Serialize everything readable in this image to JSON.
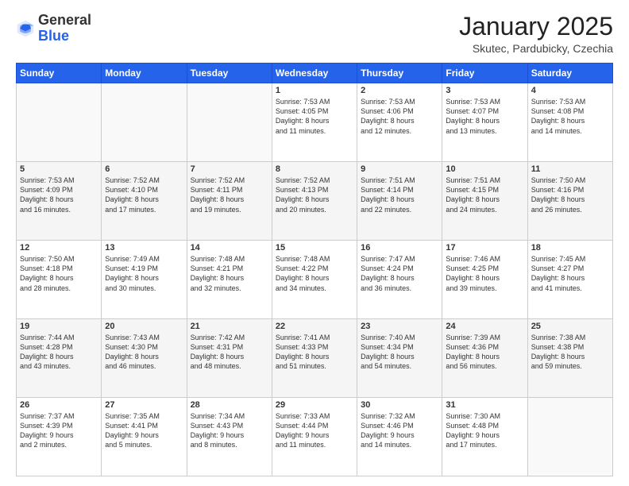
{
  "logo": {
    "general": "General",
    "blue": "Blue"
  },
  "header": {
    "month": "January 2025",
    "location": "Skutec, Pardubicky, Czechia"
  },
  "days_of_week": [
    "Sunday",
    "Monday",
    "Tuesday",
    "Wednesday",
    "Thursday",
    "Friday",
    "Saturday"
  ],
  "weeks": [
    [
      {
        "day": "",
        "info": ""
      },
      {
        "day": "",
        "info": ""
      },
      {
        "day": "",
        "info": ""
      },
      {
        "day": "1",
        "info": "Sunrise: 7:53 AM\nSunset: 4:05 PM\nDaylight: 8 hours\nand 11 minutes."
      },
      {
        "day": "2",
        "info": "Sunrise: 7:53 AM\nSunset: 4:06 PM\nDaylight: 8 hours\nand 12 minutes."
      },
      {
        "day": "3",
        "info": "Sunrise: 7:53 AM\nSunset: 4:07 PM\nDaylight: 8 hours\nand 13 minutes."
      },
      {
        "day": "4",
        "info": "Sunrise: 7:53 AM\nSunset: 4:08 PM\nDaylight: 8 hours\nand 14 minutes."
      }
    ],
    [
      {
        "day": "5",
        "info": "Sunrise: 7:53 AM\nSunset: 4:09 PM\nDaylight: 8 hours\nand 16 minutes."
      },
      {
        "day": "6",
        "info": "Sunrise: 7:52 AM\nSunset: 4:10 PM\nDaylight: 8 hours\nand 17 minutes."
      },
      {
        "day": "7",
        "info": "Sunrise: 7:52 AM\nSunset: 4:11 PM\nDaylight: 8 hours\nand 19 minutes."
      },
      {
        "day": "8",
        "info": "Sunrise: 7:52 AM\nSunset: 4:13 PM\nDaylight: 8 hours\nand 20 minutes."
      },
      {
        "day": "9",
        "info": "Sunrise: 7:51 AM\nSunset: 4:14 PM\nDaylight: 8 hours\nand 22 minutes."
      },
      {
        "day": "10",
        "info": "Sunrise: 7:51 AM\nSunset: 4:15 PM\nDaylight: 8 hours\nand 24 minutes."
      },
      {
        "day": "11",
        "info": "Sunrise: 7:50 AM\nSunset: 4:16 PM\nDaylight: 8 hours\nand 26 minutes."
      }
    ],
    [
      {
        "day": "12",
        "info": "Sunrise: 7:50 AM\nSunset: 4:18 PM\nDaylight: 8 hours\nand 28 minutes."
      },
      {
        "day": "13",
        "info": "Sunrise: 7:49 AM\nSunset: 4:19 PM\nDaylight: 8 hours\nand 30 minutes."
      },
      {
        "day": "14",
        "info": "Sunrise: 7:48 AM\nSunset: 4:21 PM\nDaylight: 8 hours\nand 32 minutes."
      },
      {
        "day": "15",
        "info": "Sunrise: 7:48 AM\nSunset: 4:22 PM\nDaylight: 8 hours\nand 34 minutes."
      },
      {
        "day": "16",
        "info": "Sunrise: 7:47 AM\nSunset: 4:24 PM\nDaylight: 8 hours\nand 36 minutes."
      },
      {
        "day": "17",
        "info": "Sunrise: 7:46 AM\nSunset: 4:25 PM\nDaylight: 8 hours\nand 39 minutes."
      },
      {
        "day": "18",
        "info": "Sunrise: 7:45 AM\nSunset: 4:27 PM\nDaylight: 8 hours\nand 41 minutes."
      }
    ],
    [
      {
        "day": "19",
        "info": "Sunrise: 7:44 AM\nSunset: 4:28 PM\nDaylight: 8 hours\nand 43 minutes."
      },
      {
        "day": "20",
        "info": "Sunrise: 7:43 AM\nSunset: 4:30 PM\nDaylight: 8 hours\nand 46 minutes."
      },
      {
        "day": "21",
        "info": "Sunrise: 7:42 AM\nSunset: 4:31 PM\nDaylight: 8 hours\nand 48 minutes."
      },
      {
        "day": "22",
        "info": "Sunrise: 7:41 AM\nSunset: 4:33 PM\nDaylight: 8 hours\nand 51 minutes."
      },
      {
        "day": "23",
        "info": "Sunrise: 7:40 AM\nSunset: 4:34 PM\nDaylight: 8 hours\nand 54 minutes."
      },
      {
        "day": "24",
        "info": "Sunrise: 7:39 AM\nSunset: 4:36 PM\nDaylight: 8 hours\nand 56 minutes."
      },
      {
        "day": "25",
        "info": "Sunrise: 7:38 AM\nSunset: 4:38 PM\nDaylight: 8 hours\nand 59 minutes."
      }
    ],
    [
      {
        "day": "26",
        "info": "Sunrise: 7:37 AM\nSunset: 4:39 PM\nDaylight: 9 hours\nand 2 minutes."
      },
      {
        "day": "27",
        "info": "Sunrise: 7:35 AM\nSunset: 4:41 PM\nDaylight: 9 hours\nand 5 minutes."
      },
      {
        "day": "28",
        "info": "Sunrise: 7:34 AM\nSunset: 4:43 PM\nDaylight: 9 hours\nand 8 minutes."
      },
      {
        "day": "29",
        "info": "Sunrise: 7:33 AM\nSunset: 4:44 PM\nDaylight: 9 hours\nand 11 minutes."
      },
      {
        "day": "30",
        "info": "Sunrise: 7:32 AM\nSunset: 4:46 PM\nDaylight: 9 hours\nand 14 minutes."
      },
      {
        "day": "31",
        "info": "Sunrise: 7:30 AM\nSunset: 4:48 PM\nDaylight: 9 hours\nand 17 minutes."
      },
      {
        "day": "",
        "info": ""
      }
    ]
  ]
}
